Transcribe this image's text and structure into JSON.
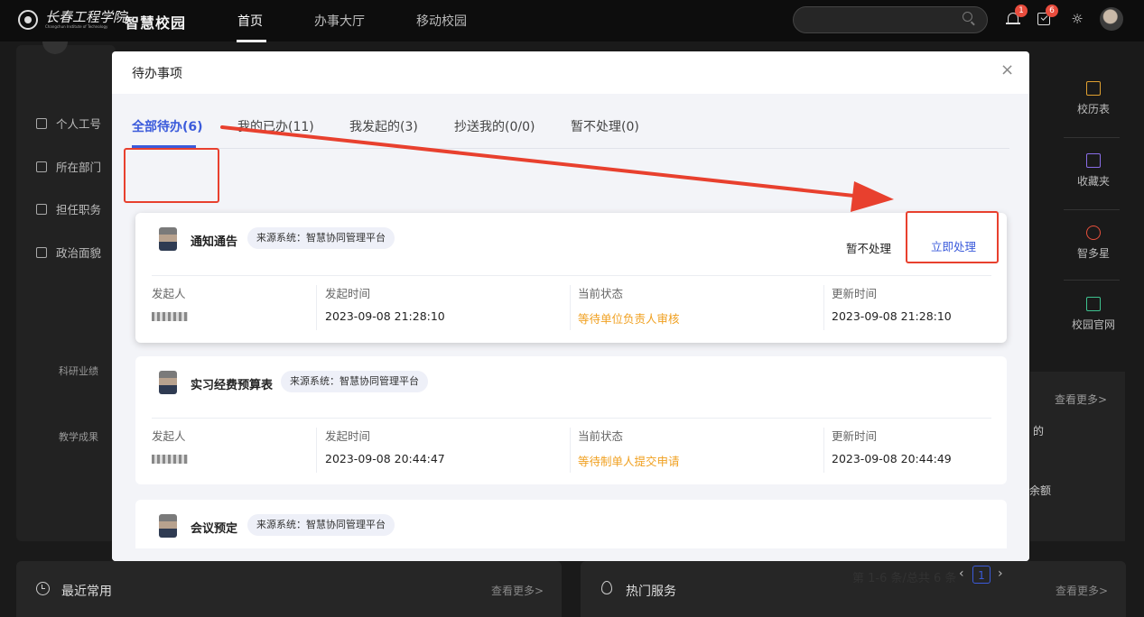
{
  "header": {
    "school_name": "长春工程学院",
    "school_name_en": "Changchun Institute of Technology",
    "app_name": "智慧校园",
    "nav": [
      "首页",
      "办事大厅",
      "移动校园"
    ],
    "active_nav": "首页",
    "notifications_count": "1",
    "tasks_count": "6"
  },
  "left_panel": {
    "items": [
      "个人工号",
      "所在部门",
      "担任职务",
      "政治面貌"
    ],
    "small_items": [
      "科研业绩",
      "教学成果"
    ]
  },
  "right_panel": {
    "items": [
      "校历表",
      "收藏夹",
      "智多星",
      "校园官网"
    ],
    "more": "查看更多>",
    "partial_texts": [
      "的",
      "余额"
    ]
  },
  "bottom": {
    "recent_title": "最近常用",
    "hot_title": "热门服务",
    "more": "查看更多>"
  },
  "modal": {
    "title": "待办事项",
    "close": "×",
    "tabs": [
      "全部待办(6)",
      "我的已办(11)",
      "我发起的(3)",
      "抄送我的(0/0)",
      "暂不处理(0)"
    ],
    "active_tab": "全部待办(6)",
    "columns": [
      "发起人",
      "发起时间",
      "当前状态",
      "更新时间"
    ],
    "items": [
      {
        "name": "通知通告",
        "source": "来源系统：智慧协同管理平台",
        "start_time": "2023-09-08 21:28:10",
        "status": "等待单位负责人审核",
        "update_time": "2023-09-08 21:28:10",
        "action_secondary": "暂不处理",
        "action_primary": "立即处理"
      },
      {
        "name": "实习经费预算表",
        "source": "来源系统：智慧协同管理平台",
        "start_time": "2023-09-08 20:44:47",
        "status": "等待制单人提交申请",
        "update_time": "2023-09-08 20:44:49"
      },
      {
        "name": "会议预定",
        "source": "来源系统：智慧协同管理平台"
      }
    ],
    "pagination": {
      "summary": "第 1-6 条/总共 6 条",
      "current_page": "1"
    }
  },
  "colors": {
    "accent": "#3b5bdb",
    "status": "#f0a020",
    "highlight": "#e8402e",
    "badge": "#e84c3d"
  }
}
